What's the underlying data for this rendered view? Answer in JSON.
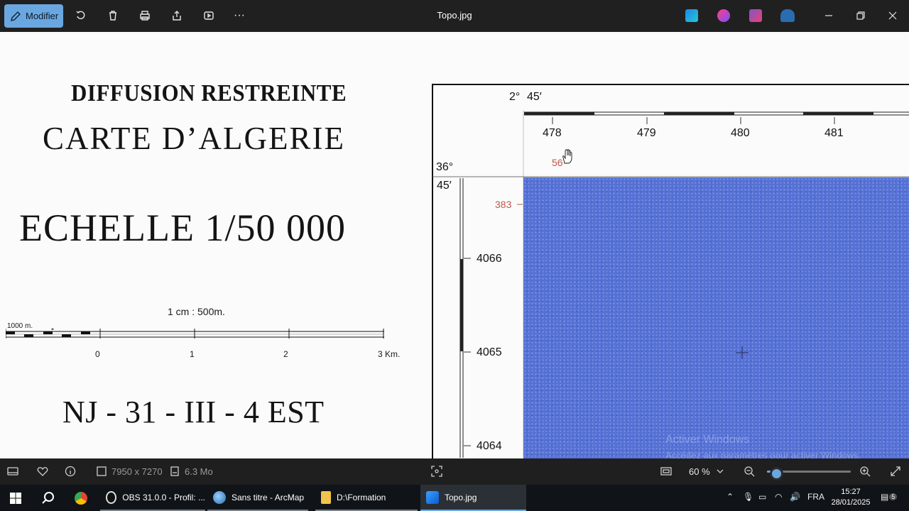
{
  "window": {
    "title": "Topo.jpg",
    "edit_label": "Modifier"
  },
  "map": {
    "header": "DIFFUSION RESTREINTE",
    "title": "CARTE D’ALGERIE",
    "scale": "ECHELLE 1/50 000",
    "scale_ratio": "1 cm : 500m.",
    "scalebar_left_label": "1000 m.",
    "scalebar_ticks": [
      "0",
      "1",
      "2",
      "3 Km."
    ],
    "sheet_id": "NJ - 31 - III - 4  EST",
    "longitude_deg": "2°",
    "longitude_min": "45′",
    "latitude_deg": "36°",
    "latitude_min": "45′",
    "eastings": [
      "478",
      "479",
      "480",
      "481"
    ],
    "northings": [
      "4066",
      "4065",
      "4064"
    ],
    "red_marks": [
      "56",
      "383"
    ],
    "watermark_line1": "Activer Windows",
    "watermark_line2": "Accédez aux paramètres pour activer Windows."
  },
  "status": {
    "dimensions": "7950 x 7270",
    "file_size": "6.3 Mo",
    "zoom": "60 %",
    "zoom_level": 0.1
  },
  "taskbar": {
    "items": [
      {
        "label": "OBS 31.0.0 - Profil: ..."
      },
      {
        "label": "Sans titre - ArcMap"
      },
      {
        "label": "D:\\Formation"
      },
      {
        "label": "Topo.jpg"
      }
    ],
    "language": "FRA",
    "time": "15:27",
    "date": "28/01/2025",
    "notifications": "5"
  },
  "colors": {
    "accent": "#6aa7e0",
    "map_blue": "#5571d6",
    "annotation_red": "#c0584a"
  }
}
